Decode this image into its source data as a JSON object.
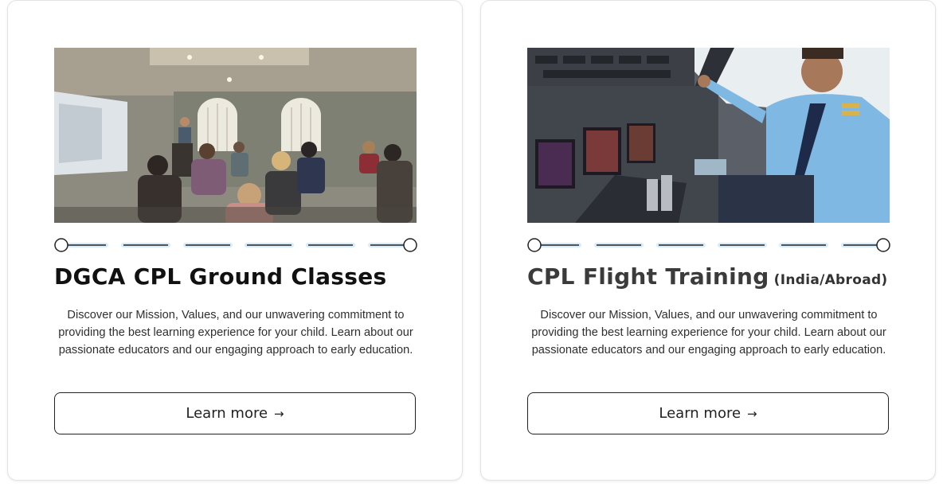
{
  "cards": [
    {
      "title": "DGCA CPL Ground Classes",
      "subtitle": "",
      "description": "Discover our Mission, Values, and our unwavering commitment to providing the best learning experience for your child. Learn about our passionate educators and our engaging approach to early education.",
      "button_label": "Learn more",
      "button_icon": "→",
      "image_icon": "classroom-photo"
    },
    {
      "title": "CPL Flight Training",
      "subtitle": "(India/Abroad)",
      "description": "Discover our Mission, Values, and our unwavering commitment to providing the best learning experience for your child. Learn about our passionate educators and our engaging approach to early education.",
      "button_label": "Learn more",
      "button_icon": "→",
      "image_icon": "cockpit-pilot-photo"
    }
  ],
  "colors": {
    "border": "#e3e3e3",
    "text_dark": "#111111",
    "progress_line": "#222222",
    "progress_glow": "#d6ecfb"
  }
}
